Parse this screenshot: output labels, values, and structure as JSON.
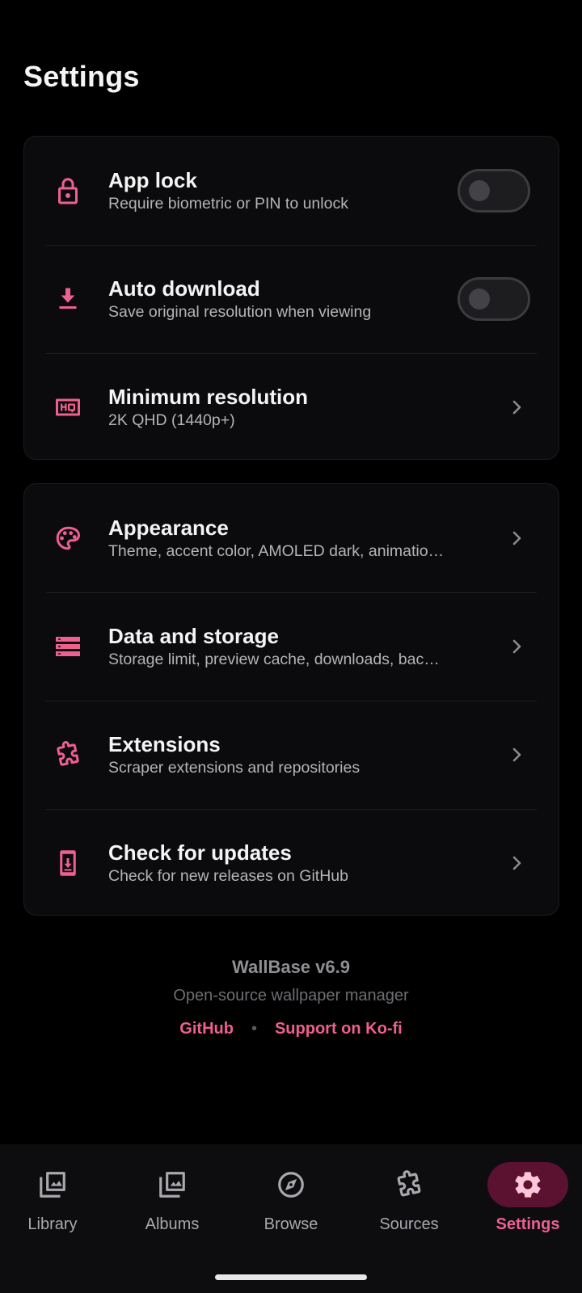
{
  "header": {
    "title": "Settings"
  },
  "colors": {
    "accent": "#ef5f8f",
    "background": "#000000",
    "card": "#0b0b0d",
    "nav_active_bg": "#5a1230"
  },
  "group1": {
    "app_lock": {
      "title": "App lock",
      "subtitle": "Require biometric or PIN to unlock",
      "icon": "lock-icon",
      "enabled": false
    },
    "auto_download": {
      "title": "Auto download",
      "subtitle": "Save original resolution when viewing",
      "icon": "download-icon",
      "enabled": false
    },
    "min_resolution": {
      "title": "Minimum resolution",
      "subtitle": "2K QHD (1440p+)",
      "icon": "hq-icon"
    }
  },
  "group2": {
    "appearance": {
      "title": "Appearance",
      "subtitle": "Theme, accent color, AMOLED dark, animatio…",
      "icon": "palette-icon"
    },
    "data_storage": {
      "title": "Data and storage",
      "subtitle": "Storage limit, preview cache, downloads, bac…",
      "icon": "storage-icon"
    },
    "extensions": {
      "title": "Extensions",
      "subtitle": "Scraper extensions and repositories",
      "icon": "puzzle-icon"
    },
    "updates": {
      "title": "Check for updates",
      "subtitle": "Check for new releases on GitHub",
      "icon": "system-update-icon"
    }
  },
  "footer": {
    "version": "WallBase v6.9",
    "tagline": "Open-source wallpaper manager",
    "github": "GitHub",
    "separator": "•",
    "kofi": "Support on Ko-fi"
  },
  "nav": {
    "library": "Library",
    "albums": "Albums",
    "browse": "Browse",
    "sources": "Sources",
    "settings": "Settings",
    "active": "settings"
  }
}
